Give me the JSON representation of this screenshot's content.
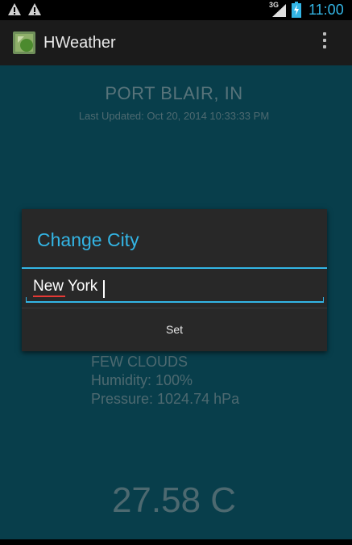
{
  "status_bar": {
    "network_label": "3G",
    "time": "11:00",
    "accent_color": "#33b5e5",
    "icons": [
      "warning-icon",
      "warning-icon",
      "signal-icon",
      "battery-charging-icon"
    ]
  },
  "action_bar": {
    "title": "HWeather",
    "app_icon": "app-icon",
    "menu_icon": "overflow-menu-icon"
  },
  "weather": {
    "city": "PORT BLAIR, IN",
    "last_updated": "Last Updated: Oct 20, 2014 10:33:33 PM",
    "description": "FEW CLOUDS",
    "humidity": "Humidity: 100%",
    "pressure": "Pressure: 1024.74 hPa",
    "temperature": "27.58 C"
  },
  "dialog": {
    "title": "Change City",
    "input_value": "New York",
    "set_label": "Set"
  },
  "colors": {
    "background": "#0a4c5c",
    "dialog_background": "#282828",
    "accent": "#33b5e5"
  }
}
